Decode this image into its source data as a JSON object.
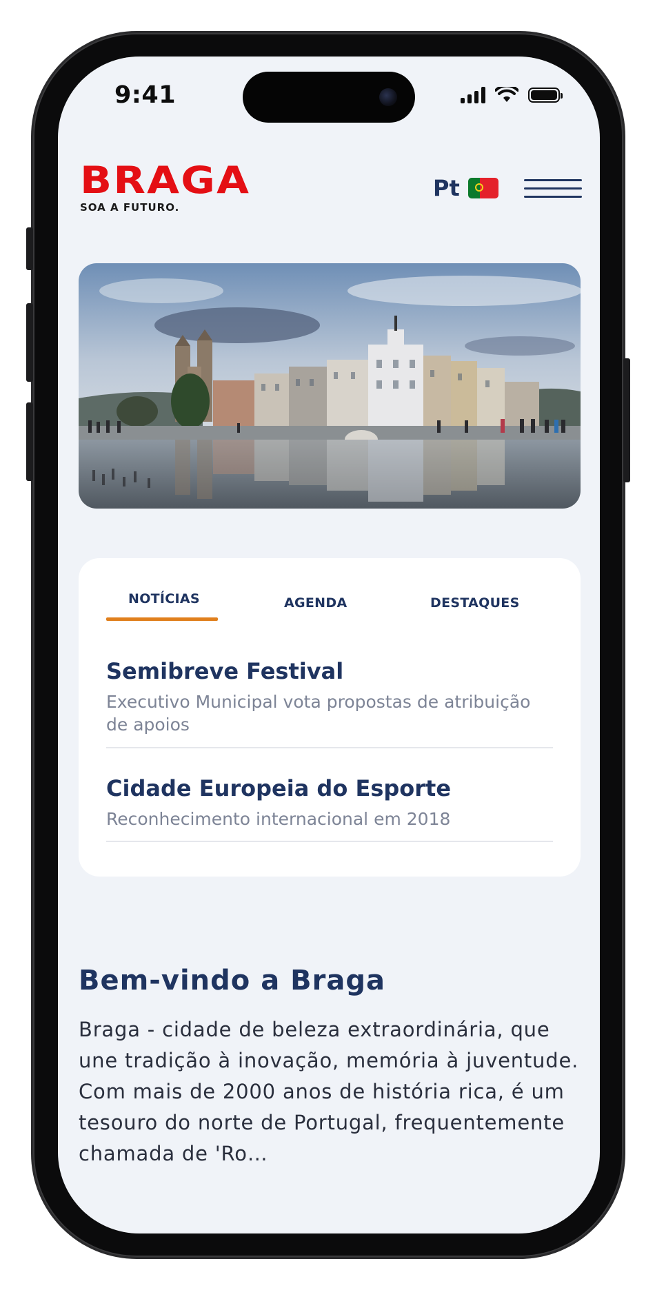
{
  "status_bar": {
    "time": "9:41"
  },
  "header": {
    "logo_text": "BRAGA",
    "logo_tagline": "SOA A FUTURO.",
    "language_label": "Pt",
    "flag_icon": "portugal-flag-icon",
    "menu_icon": "hamburger-menu-icon"
  },
  "hero": {
    "image": "braga-city-square-photo"
  },
  "news_card": {
    "tabs": [
      {
        "label": "NOTÍCIAS",
        "active": true
      },
      {
        "label": "AGENDA",
        "active": false
      },
      {
        "label": "DESTAQUES",
        "active": false
      }
    ],
    "accent_color": "#e07f1c",
    "items": [
      {
        "title": "Semibreve Festival",
        "subtitle": "Executivo Municipal vota propostas de atribuição de apoios"
      },
      {
        "title": "Cidade Europeia do Esporte",
        "subtitle": "Reconhecimento internacional em 2018"
      }
    ]
  },
  "welcome": {
    "title": "Bem-vindo a Braga",
    "body": "Braga - cidade de beleza extraordinária, que une tradição à inovação, memória à juventude. Com mais de 2000 anos de história rica, é um tesouro do norte de Portugal, frequentemente chamada de 'Ro…"
  },
  "colors": {
    "brand_red": "#e40f14",
    "navy": "#1f3460",
    "background": "#f0f3f8"
  }
}
